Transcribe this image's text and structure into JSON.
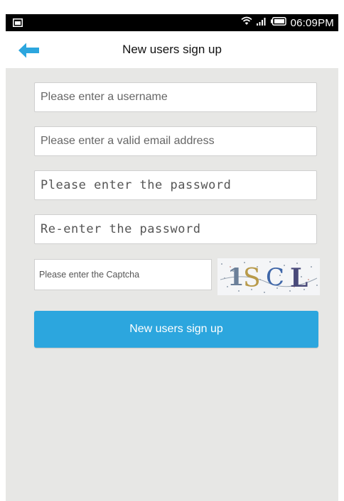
{
  "status_bar": {
    "time": "06:09PM",
    "icons": [
      "screenshot-icon",
      "wifi-icon",
      "signal-icon",
      "battery-icon"
    ]
  },
  "header": {
    "back_icon": "back-arrow-icon",
    "title": "New users sign up"
  },
  "form": {
    "username_placeholder": "Please enter a username",
    "email_placeholder": "Please enter a valid email address",
    "password_placeholder": "Please enter the password",
    "confirm_password_placeholder": "Re-enter the password",
    "captcha_placeholder": "Please enter the Captcha",
    "captcha_text": "1SCL",
    "submit_label": "New users sign up"
  },
  "colors": {
    "accent": "#2ca6de",
    "background": "#e7e7e5",
    "status_bar": "#000000"
  }
}
